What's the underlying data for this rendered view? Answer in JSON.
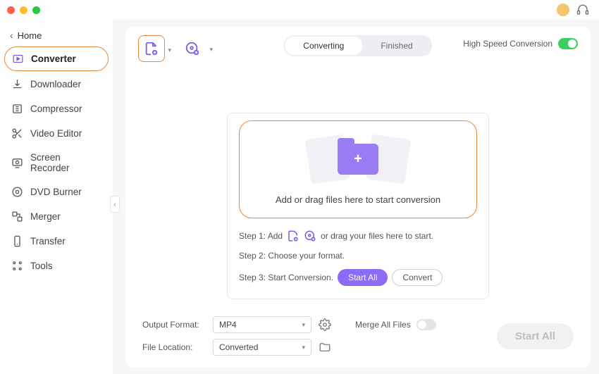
{
  "home_label": "Home",
  "sidebar": {
    "items": [
      {
        "label": "Converter"
      },
      {
        "label": "Downloader"
      },
      {
        "label": "Compressor"
      },
      {
        "label": "Video Editor"
      },
      {
        "label": "Screen Recorder"
      },
      {
        "label": "DVD Burner"
      },
      {
        "label": "Merger"
      },
      {
        "label": "Transfer"
      },
      {
        "label": "Tools"
      }
    ]
  },
  "tabs": {
    "converting": "Converting",
    "finished": "Finished"
  },
  "speed_label": "High Speed Conversion",
  "drop_text": "Add or drag files here to start conversion",
  "steps": {
    "s1_pre": "Step 1: Add",
    "s1_post": "or drag your files here to start.",
    "s2": "Step 2: Choose your format.",
    "s3": "Step 3: Start Conversion.",
    "start_all": "Start  All",
    "convert": "Convert"
  },
  "footer": {
    "output_format_label": "Output Format:",
    "output_format_value": "MP4",
    "file_location_label": "File Location:",
    "file_location_value": "Converted",
    "merge_label": "Merge All Files",
    "start_all_btn": "Start All"
  }
}
